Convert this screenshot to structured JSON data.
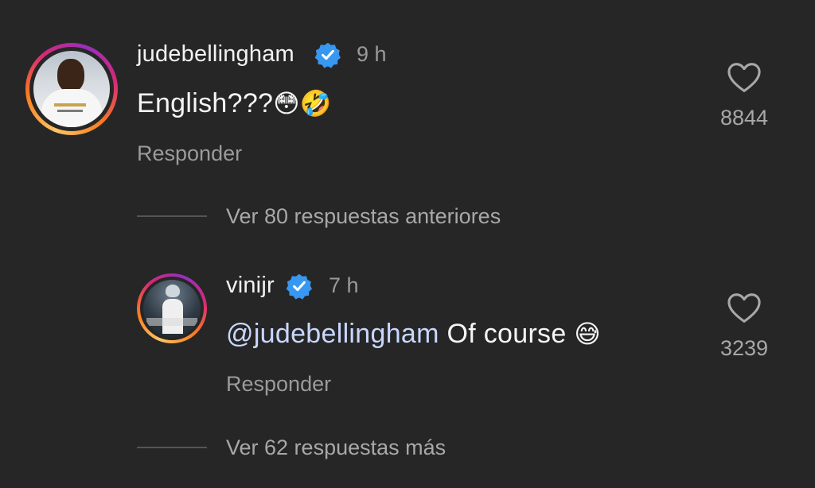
{
  "comments": [
    {
      "username": "judebellingham",
      "time": "9 h",
      "text": "English???",
      "emoji": "😳🤣",
      "reply_label": "Responder",
      "likes": "8844",
      "avatar_icon": "profile-photo-white-jersey"
    },
    {
      "username": "vinijr",
      "time": "7 h",
      "mention": "@judebellingham",
      "text": " Of course ",
      "emoji": "😅",
      "reply_label": "Responder",
      "likes": "3239",
      "avatar_icon": "profile-photo-trophy"
    }
  ],
  "view_previous": "Ver 80 respuestas anteriores",
  "view_more": "Ver 62 respuestas más",
  "colors": {
    "background": "#262626",
    "verified_blue": "#3897f0",
    "mention": "#c9d7ff",
    "secondary_text": "#9b9b9b"
  }
}
